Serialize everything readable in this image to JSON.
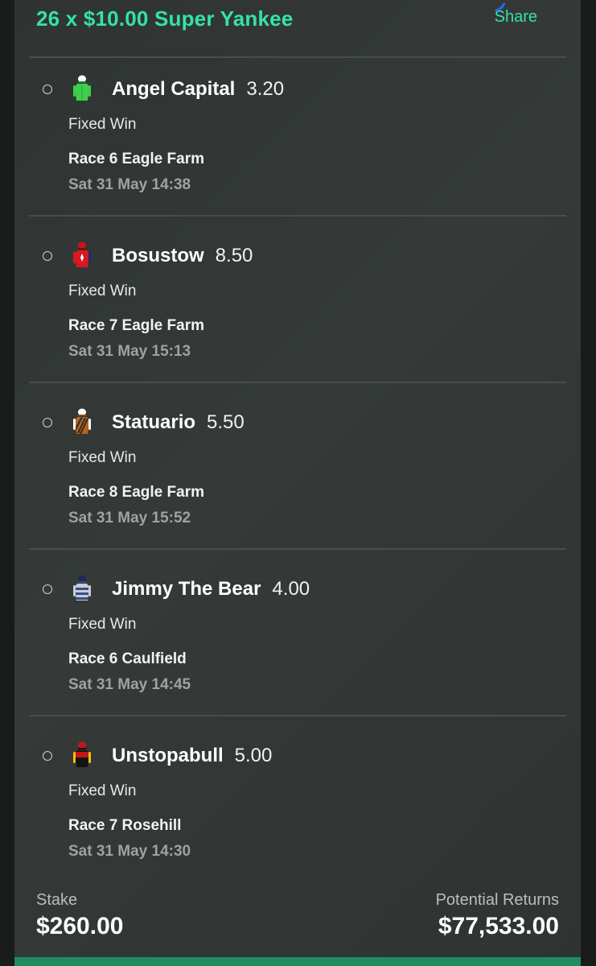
{
  "bet": {
    "title": "26 x $10.00 Super Yankee",
    "share_label": "Share"
  },
  "legs": [
    {
      "runner": "Angel Capital",
      "odds": "3.20",
      "bet_type": "Fixed Win",
      "race": "Race 6 Eagle Farm",
      "time": "Sat 31 May 14:38",
      "silk_icon": "green-silk-icon"
    },
    {
      "runner": "Bosustow",
      "odds": "8.50",
      "bet_type": "Fixed Win",
      "race": "Race 7 Eagle Farm",
      "time": "Sat 31 May 15:13",
      "silk_icon": "red-silk-icon"
    },
    {
      "runner": "Statuario",
      "odds": "5.50",
      "bet_type": "Fixed Win",
      "race": "Race 8 Eagle Farm",
      "time": "Sat 31 May 15:52",
      "silk_icon": "brown-striped-silk-icon"
    },
    {
      "runner": "Jimmy The Bear",
      "odds": "4.00",
      "bet_type": "Fixed Win",
      "race": "Race 6 Caulfield",
      "time": "Sat 31 May 14:45",
      "silk_icon": "grey-hooped-silk-icon"
    },
    {
      "runner": "Unstopabull",
      "odds": "5.00",
      "bet_type": "Fixed Win",
      "race": "Race 7 Rosehill",
      "time": "Sat 31 May 14:30",
      "silk_icon": "black-yellow-red-silk-icon"
    }
  ],
  "summary": {
    "stake_label": "Stake",
    "stake_value": "$260.00",
    "returns_label": "Potential Returns",
    "returns_value": "$77,533.00"
  },
  "colors": {
    "accent": "#34e2a9",
    "card_background": "#323735",
    "divider": "#494e4c",
    "bottom_bar": "#1f8c62"
  }
}
